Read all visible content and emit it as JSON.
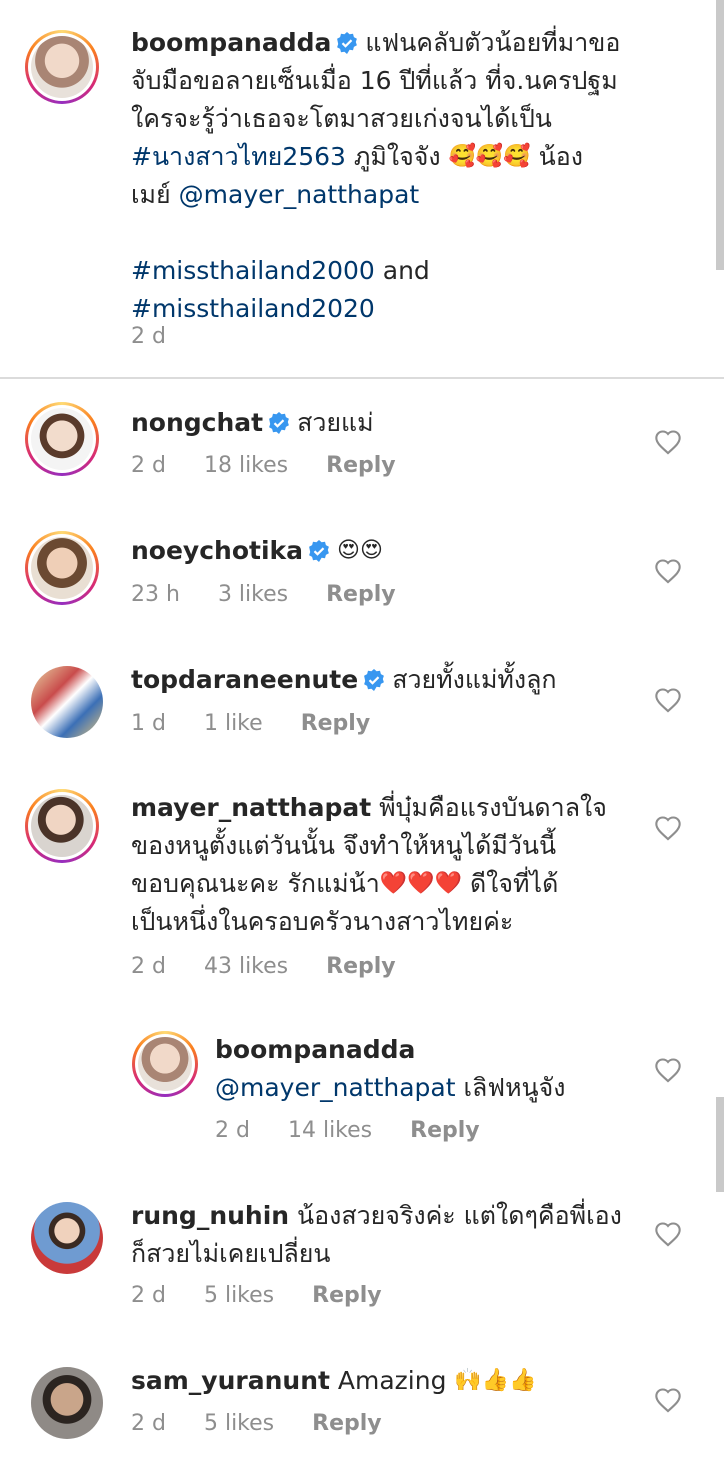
{
  "caption": {
    "username": "boompanadda",
    "lines": [
      "แฟนคลับตัวน้อยที่มาขอ",
      "จับมือขอลายเซ็นเมื่อ 16 ปีที่แล้ว ที่จ.นครปฐม",
      "ใครจะรู้ว่าเธอจะโตมาสวยเก่งจนได้เป็น",
      "#นางสาวไทย2563",
      "ภูมิใจจัง",
      "🥰🥰🥰",
      "น้อง",
      "เมย์",
      "@mayer_natthapat",
      "#missthailand2000",
      "and",
      "#missthailand2020"
    ],
    "time": "2 d"
  },
  "comments": [
    {
      "username": "nongchat",
      "verified": true,
      "text": "สวยแม่",
      "time": "2 d",
      "likes": "18 likes",
      "reply": "Reply"
    },
    {
      "username": "noeychotika",
      "verified": true,
      "text": "😍😍",
      "time": "23 h",
      "likes": "3 likes",
      "reply": "Reply"
    },
    {
      "username": "topdaraneenute",
      "verified": true,
      "text": "สวยทั้งแม่ทั้งลูก",
      "time": "1 d",
      "likes": "1 like",
      "reply": "Reply"
    },
    {
      "username": "mayer_natthapat",
      "verified": false,
      "lines": [
        "พี่บุ๋มคือแรงบันดาลใจ",
        "ของหนูตั้งแต่วันนั้น จึงทำให้หนูได้มีวันนี้",
        "ขอบคุณนะคะ รักแม่น้า",
        "❤️❤️❤️",
        "ดีใจที่ได้",
        "เป็นหนึ่งในครอบครัวนางสาวไทยค่ะ"
      ],
      "time": "2 d",
      "likes": "43 likes",
      "reply": "Reply"
    },
    {
      "username": "boompanadda",
      "verified": false,
      "mention": "@mayer_natthapat",
      "text": "เลิฟหนูจัง",
      "time": "2 d",
      "likes": "14 likes",
      "reply": "Reply"
    },
    {
      "username": "rung_nuhin",
      "verified": false,
      "lines": [
        "น้องสวยจริงค่ะ แต่ใดๆคือพี่เอง",
        "ก็สวยไม่เคยเปลี่ยน"
      ],
      "time": "2 d",
      "likes": "5 likes",
      "reply": "Reply"
    },
    {
      "username": "sam_yuranunt",
      "verified": false,
      "text": "Amazing",
      "emoji": "🙌👍👍",
      "time": "2 d",
      "likes": "5 likes",
      "reply": "Reply"
    }
  ],
  "colors": {
    "link": "#00376b",
    "verified": "#3897f0",
    "meta": "#8e8e8e"
  }
}
